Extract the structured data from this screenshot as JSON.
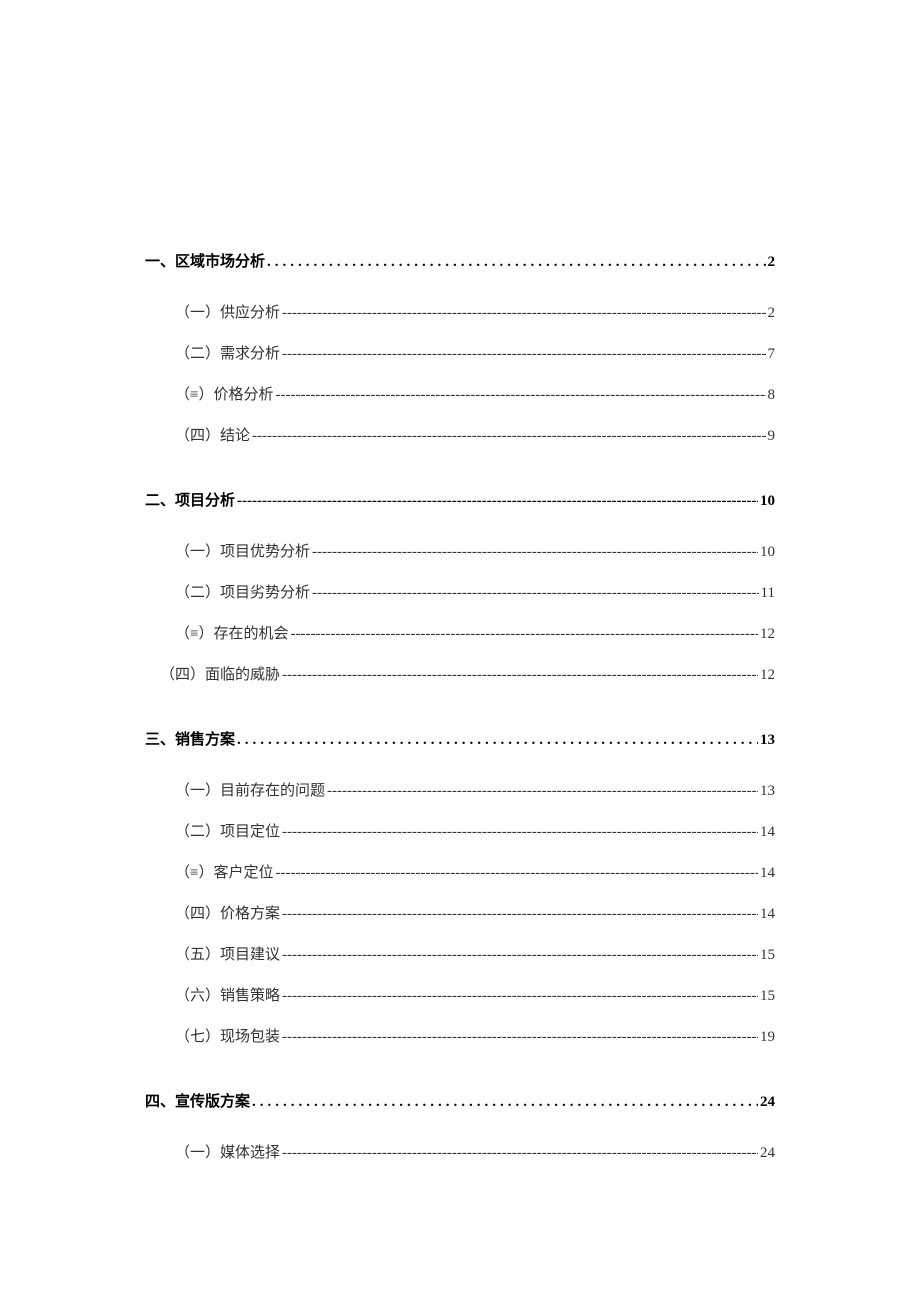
{
  "toc": {
    "sections": [
      {
        "label": "一、区域市场分析",
        "page": "2",
        "leader": "dots",
        "items": [
          {
            "label": "（一）供应分析",
            "page": "2",
            "indent": "std"
          },
          {
            "label": "（二）需求分析",
            "page": "7",
            "indent": "std"
          },
          {
            "label": "（≡）价格分析",
            "page": "8",
            "indent": "std"
          },
          {
            "label": "（四）结论",
            "page": "9",
            "indent": "std"
          }
        ]
      },
      {
        "label": "二、项目分析",
        "page": "10",
        "leader": "dashes",
        "items": [
          {
            "label": "（一）项目优势分析",
            "page": "10",
            "indent": "std"
          },
          {
            "label": "（二）项目劣势分析",
            "page": "11",
            "indent": "std"
          },
          {
            "label": "（≡）存在的机会",
            "page": "12",
            "indent": "std"
          },
          {
            "label": "（四）面临的威胁",
            "page": "12",
            "indent": "un"
          }
        ]
      },
      {
        "label": "三、销售方案",
        "page": "13",
        "leader": "dots",
        "items": [
          {
            "label": "（一）目前存在的问题",
            "page": "13",
            "indent": "std"
          },
          {
            "label": "（二）项目定位",
            "page": "14",
            "indent": "std"
          },
          {
            "label": "（≡）客户定位",
            "page": "14",
            "indent": "std"
          },
          {
            "label": "（四）价格方案",
            "page": "14",
            "indent": "std"
          },
          {
            "label": "（五）项目建议",
            "page": "15",
            "indent": "std"
          },
          {
            "label": "（六）销售策略",
            "page": "15",
            "indent": "std"
          },
          {
            "label": "（七）现场包装",
            "page": "19",
            "indent": "std"
          }
        ]
      },
      {
        "label": "四、宣传版方案",
        "page": "24",
        "leader": "dots",
        "items": [
          {
            "label": "（一）媒体选择",
            "page": "24",
            "indent": "std"
          }
        ]
      }
    ]
  }
}
